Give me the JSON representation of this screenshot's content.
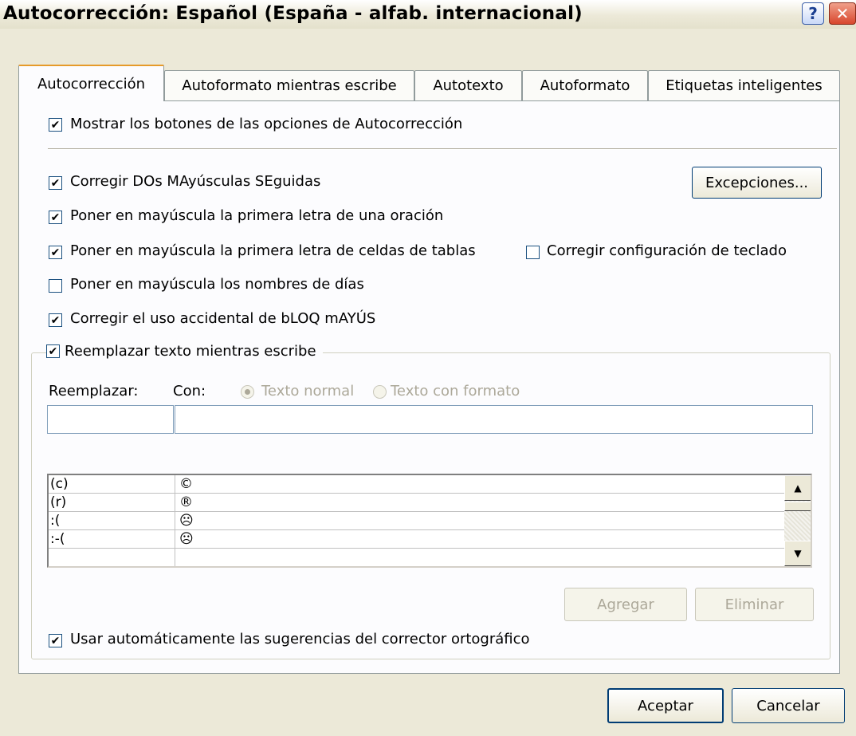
{
  "window": {
    "title": "Autocorrección: Español (España - alfab. internacional)",
    "help_glyph": "?",
    "close_glyph": "✕"
  },
  "tabs": [
    {
      "label": "Autocorrección",
      "active": true
    },
    {
      "label": "Autoformato mientras escribe"
    },
    {
      "label": "Autotexto"
    },
    {
      "label": "Autoformato"
    },
    {
      "label": "Etiquetas inteligentes"
    }
  ],
  "options": {
    "show_buttons": {
      "label": "Mostrar los botones de las opciones de Autocorrección",
      "checked": true
    },
    "two_caps": {
      "label": "Corregir DOs MAyúsculas SEguidas",
      "checked": true
    },
    "sentence_cap": {
      "label": "Poner en mayúscula la primera letra de una oración",
      "checked": true
    },
    "table_cap": {
      "label": "Poner en mayúscula la primera letra de celdas de tablas",
      "checked": true
    },
    "keyboard": {
      "label": "Corregir configuración de teclado",
      "checked": false
    },
    "day_names": {
      "label": "Poner en mayúscula los nombres de días",
      "checked": false
    },
    "caps_lock": {
      "label": "Corregir el uso accidental de bLOQ mAYÚS",
      "checked": true
    },
    "replace_text": {
      "label": "Reemplazar texto mientras escribe",
      "checked": true
    },
    "spell_suggest": {
      "label": "Usar automáticamente las sugerencias del corrector ortográfico",
      "checked": true
    }
  },
  "buttons": {
    "exceptions": "Excepciones...",
    "add": "Agregar",
    "delete": "Eliminar",
    "ok": "Aceptar",
    "cancel": "Cancelar"
  },
  "replace": {
    "replace_label": "Reemplazar:",
    "with_label": "Con:",
    "plain_text": "Texto normal",
    "formatted_text": "Texto con formato",
    "replace_value": "",
    "with_value": ""
  },
  "entries": [
    {
      "from": "(c)",
      "to": "©"
    },
    {
      "from": "(r)",
      "to": "®"
    },
    {
      "from": ":(",
      "to": "☹"
    },
    {
      "from": ":-(",
      "to": "☹"
    }
  ],
  "scroll_glyphs": {
    "up": "▲",
    "down": "▼"
  },
  "colors": {
    "dialog_bg": "#ece9d8",
    "panel_bg": "#fcfcfe",
    "active_tab_accent": "#e69b2a"
  }
}
